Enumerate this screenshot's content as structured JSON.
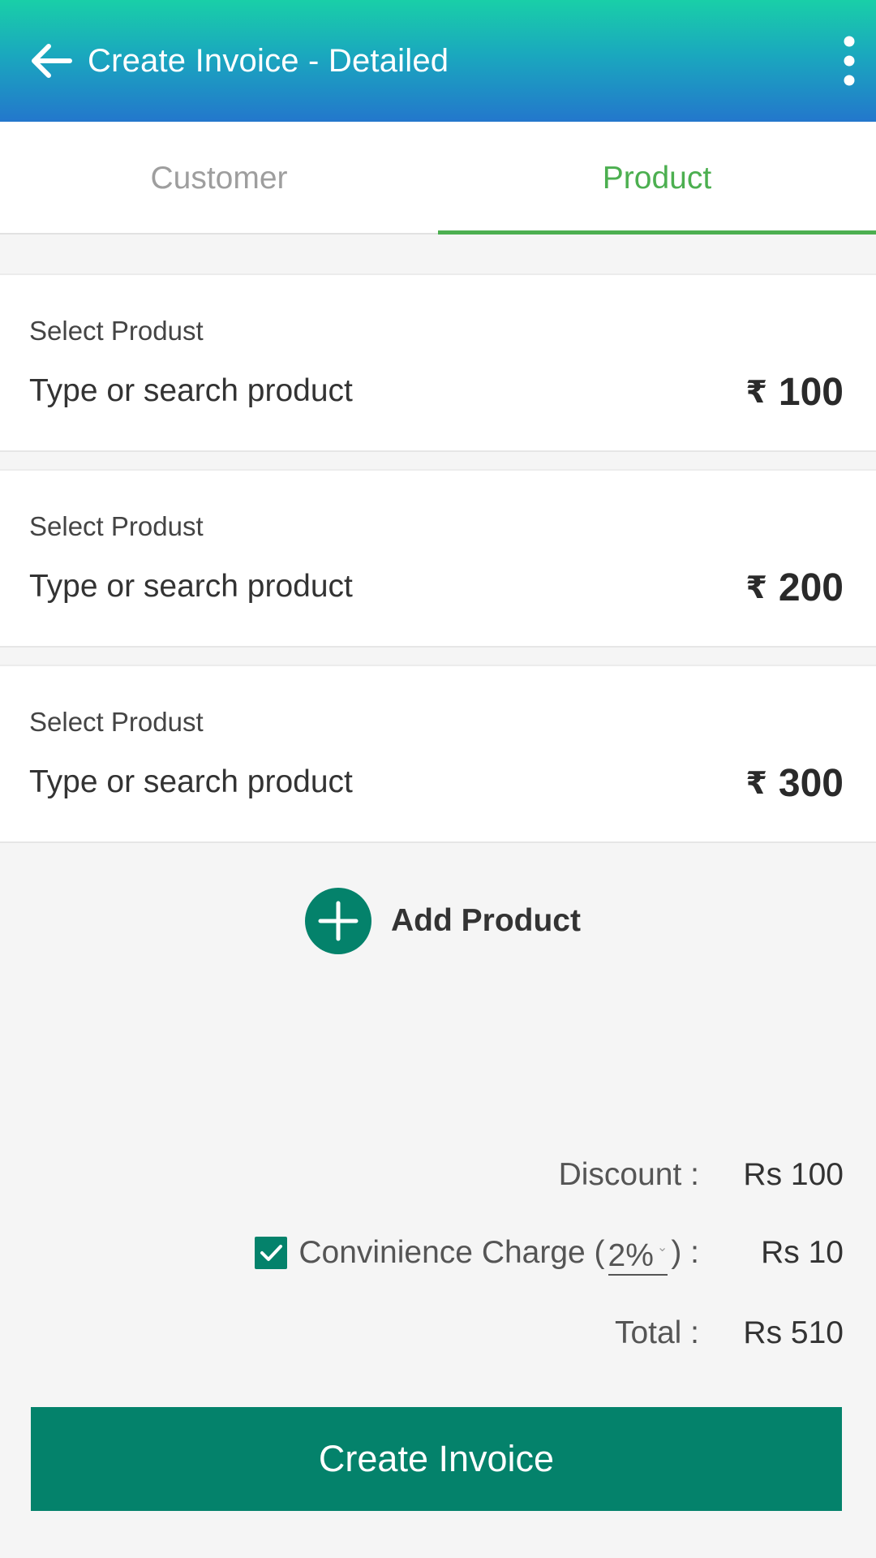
{
  "appbar": {
    "title": "Create Invoice - Detailed",
    "back_icon": "arrow-left-icon",
    "menu_icon": "more-vert-icon"
  },
  "tabs": [
    {
      "label": "Customer",
      "active": false
    },
    {
      "label": "Product",
      "active": true
    }
  ],
  "products": [
    {
      "label": "Select Produst",
      "placeholder": "Type or search product",
      "currency": "₹",
      "price": "100"
    },
    {
      "label": "Select Produst",
      "placeholder": "Type or search product",
      "currency": "₹",
      "price": "200"
    },
    {
      "label": "Select Produst",
      "placeholder": "Type or search product",
      "currency": "₹",
      "price": "300"
    }
  ],
  "add_product": {
    "label": "Add Product",
    "icon": "add-circle-icon"
  },
  "summary": {
    "discount_label": "Discount :",
    "discount_value": "Rs 100",
    "convenience_prefix": "Convinience Charge (",
    "convenience_percent": "2%",
    "convenience_suffix": ") :",
    "convenience_checked": true,
    "convenience_value": "Rs 10",
    "total_label": "Total :",
    "total_value": "Rs 510"
  },
  "create_button": {
    "label": "Create Invoice"
  },
  "colors": {
    "header_gradient_top": "#19cfa8",
    "header_gradient_bottom": "#2377cc",
    "active_tab": "#4caf50",
    "primary_teal": "#04826b"
  }
}
